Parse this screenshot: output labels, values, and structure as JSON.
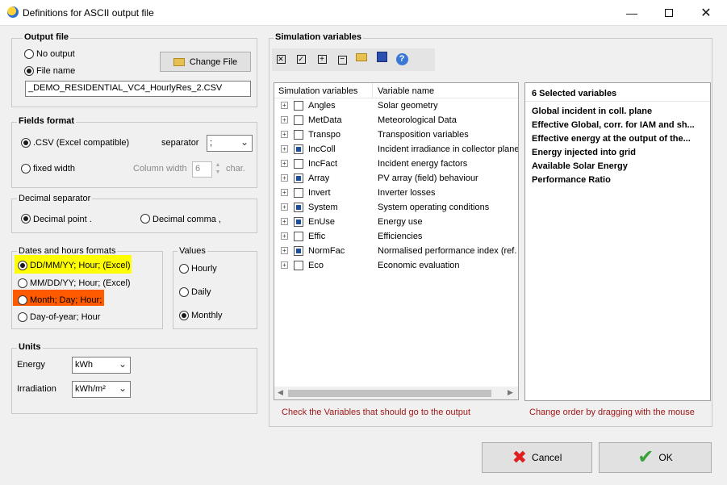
{
  "window": {
    "title": "Definitions for ASCII output file"
  },
  "output_file": {
    "group_label": "Output file",
    "no_output_label": "No output",
    "file_name_label": "File name",
    "change_file_label": "Change File",
    "file_name_value": "_DEMO_RESIDENTIAL_VC4_HourlyRes_2.CSV"
  },
  "fields_format": {
    "group_label": "Fields format",
    "csv_label": ".CSV (Excel compatible)",
    "separator_label": "separator",
    "separator_value": ";",
    "fixed_width_label": "fixed width",
    "column_width_label": "Column width",
    "column_width_value": "6",
    "char_label": "char."
  },
  "decimal_separator": {
    "group_label": "Decimal separator",
    "point_label": "Decimal point .",
    "comma_label": "Decimal comma ,"
  },
  "dates": {
    "group_label": "Dates and hours formats",
    "opt1": "DD/MM/YY; Hour;  (Excel)",
    "opt2": "MM/DD/YY; Hour;  (Excel)",
    "opt3": "Month; Day; Hour;",
    "opt4": "Day-of-year; Hour"
  },
  "values": {
    "group_label": "Values",
    "hourly": "Hourly",
    "daily": "Daily",
    "monthly": "Monthly"
  },
  "units": {
    "group_label": "Units",
    "energy_label": "Energy",
    "energy_value": "kWh",
    "irradiation_label": "Irradiation",
    "irradiation_value": "kWh/m²"
  },
  "simulation": {
    "group_label": "Simulation variables",
    "col_sim": "Simulation variables",
    "col_name": "Variable name",
    "rows": [
      {
        "name": "Angles",
        "desc": "Solar geometry",
        "checked": false
      },
      {
        "name": "MetData",
        "desc": "Meteorological Data",
        "checked": false
      },
      {
        "name": "Transpo",
        "desc": "Transposition variables",
        "checked": false
      },
      {
        "name": "IncColl",
        "desc": "Incident irradiance in collector plane",
        "checked": true
      },
      {
        "name": "IncFact",
        "desc": "Incident energy factors",
        "checked": false
      },
      {
        "name": "Array",
        "desc": "PV array (field) behaviour",
        "checked": true
      },
      {
        "name": "Invert",
        "desc": "Inverter losses",
        "checked": false
      },
      {
        "name": "System",
        "desc": "System operating conditions",
        "checked": true
      },
      {
        "name": "EnUse",
        "desc": "Energy use",
        "checked": true
      },
      {
        "name": "Effic",
        "desc": "Efficiencies",
        "checked": false
      },
      {
        "name": "NormFac",
        "desc": "Normalised performance index (ref.",
        "checked": true
      },
      {
        "name": "Eco",
        "desc": "Economic evaluation",
        "checked": false
      }
    ],
    "hint_left": "Check the Variables that should go to the output",
    "hint_right": "Change order by dragging with the mouse"
  },
  "selected": {
    "header": "6 Selected variables",
    "items": [
      "Global incident in coll. plane",
      "Effective Global, corr. for IAM and sh...",
      "Effective energy at the output of the...",
      "Energy injected into grid",
      "Available Solar Energy",
      "Performance Ratio"
    ]
  },
  "buttons": {
    "cancel": "Cancel",
    "ok": "OK"
  },
  "colors": {
    "highlight_yellow": "#ffff00",
    "highlight_orange": "#ff5a00",
    "hint_red": "#a01818",
    "ok_green": "#3aa03a",
    "cancel_red": "#e02020"
  }
}
